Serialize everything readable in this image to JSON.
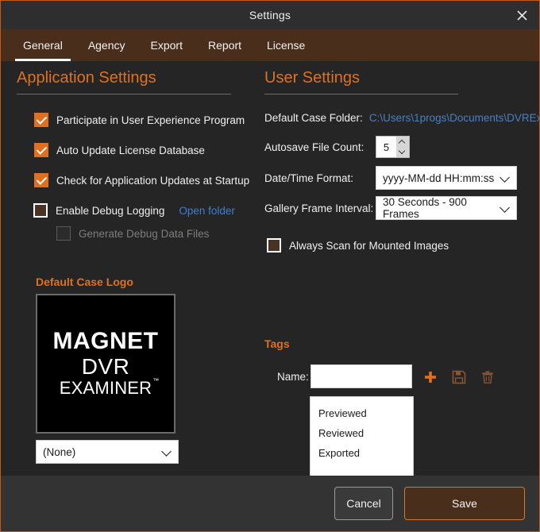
{
  "window": {
    "title": "Settings",
    "close_icon": "close-icon"
  },
  "tabs": [
    {
      "label": "General",
      "active": true
    },
    {
      "label": "Agency",
      "active": false
    },
    {
      "label": "Export",
      "active": false
    },
    {
      "label": "Report",
      "active": false
    },
    {
      "label": "License",
      "active": false
    }
  ],
  "application_settings": {
    "heading": "Application Settings",
    "checkboxes": [
      {
        "label": "Participate in User Experience Program",
        "checked": true,
        "enabled": true
      },
      {
        "label": "Auto Update License Database",
        "checked": true,
        "enabled": true
      },
      {
        "label": "Check for Application Updates at Startup",
        "checked": true,
        "enabled": true
      },
      {
        "label": "Enable Debug Logging",
        "checked": false,
        "enabled": true
      },
      {
        "label": "Generate Debug Data Files",
        "checked": false,
        "enabled": false
      }
    ],
    "open_folder_link": "Open folder"
  },
  "default_case_logo": {
    "heading": "Default Case Logo",
    "logo_line1": "MAGNET",
    "logo_line2": "DVR",
    "logo_line3": "EXAMINER",
    "logo_trademark": "™",
    "select_value": "(None)"
  },
  "user_settings": {
    "heading": "User Settings",
    "default_case_folder_label": "Default Case Folder:",
    "default_case_folder_value": "C:\\Users\\1progs\\Documents\\DVREx...",
    "autosave_label": "Autosave File Count:",
    "autosave_value": "5",
    "datetime_label": "Date/Time Format:",
    "datetime_value": "yyyy-MM-dd HH:mm:ss",
    "gallery_label": "Gallery Frame Interval:",
    "gallery_value": "30 Seconds - 900 Frames",
    "always_scan_label": "Always Scan for Mounted Images",
    "always_scan_checked": false
  },
  "tags": {
    "heading": "Tags",
    "name_label": "Name:",
    "name_value": "",
    "name_placeholder": "",
    "add_icon": "plus-icon",
    "save_icon": "floppy-disk-icon",
    "delete_icon": "trash-icon",
    "items": [
      "Previewed",
      "Reviewed",
      "Exported"
    ]
  },
  "footer": {
    "cancel_label": "Cancel",
    "save_label": "Save"
  },
  "colors": {
    "accent": "#e0701f",
    "tabbar": "#4a2e1c",
    "window_bg": "#252525",
    "titlebar": "#2e2e2e",
    "footer": "#333333",
    "link": "#4a7fc0"
  }
}
